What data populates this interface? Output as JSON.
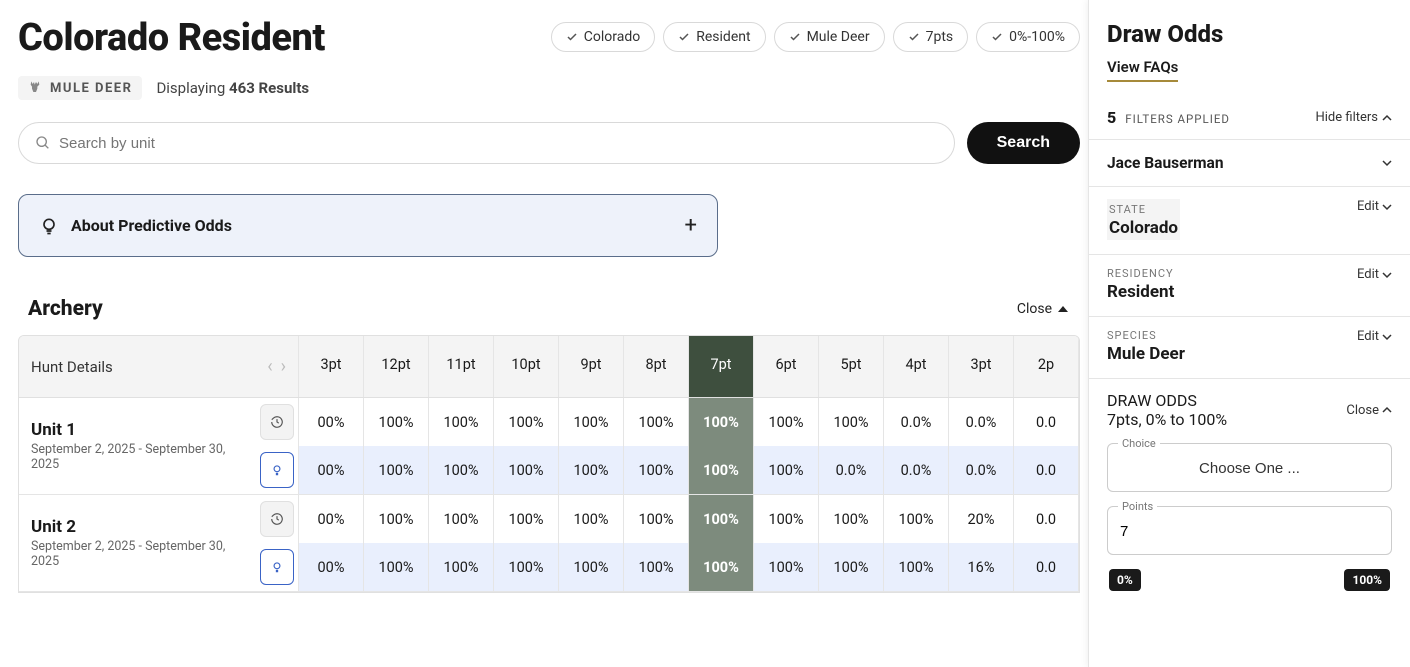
{
  "header": {
    "title": "Colorado Resident",
    "chips": [
      "Colorado",
      "Resident",
      "Mule Deer",
      "7pts",
      "0%-100%"
    ]
  },
  "species_badge": "MULE DEER",
  "results": {
    "prefix": "Displaying",
    "count": "463 Results"
  },
  "search": {
    "placeholder": "Search by unit",
    "button": "Search"
  },
  "about": {
    "title": "About Predictive Odds"
  },
  "section": {
    "title": "Archery",
    "close": "Close"
  },
  "table": {
    "hunt_details_label": "Hunt Details",
    "columns": [
      "3pt",
      "12pt",
      "11pt",
      "10pt",
      "9pt",
      "8pt",
      "7pt",
      "6pt",
      "5pt",
      "4pt",
      "3pt",
      "2p"
    ],
    "active_col_index": 6,
    "units": [
      {
        "name": "Unit 1",
        "dates": "September 2, 2025 - September 30, 2025",
        "rows": [
          [
            "00%",
            "100%",
            "100%",
            "100%",
            "100%",
            "100%",
            "100%",
            "100%",
            "100%",
            "0.0%",
            "0.0%",
            "0.0"
          ],
          [
            "00%",
            "100%",
            "100%",
            "100%",
            "100%",
            "100%",
            "100%",
            "100%",
            "0.0%",
            "0.0%",
            "0.0%",
            "0.0"
          ]
        ]
      },
      {
        "name": "Unit 2",
        "dates": "September 2, 2025 - September 30, 2025",
        "rows": [
          [
            "00%",
            "100%",
            "100%",
            "100%",
            "100%",
            "100%",
            "100%",
            "100%",
            "100%",
            "100%",
            "20%",
            "0.0"
          ],
          [
            "00%",
            "100%",
            "100%",
            "100%",
            "100%",
            "100%",
            "100%",
            "100%",
            "100%",
            "100%",
            "16%",
            "0.0"
          ]
        ]
      }
    ]
  },
  "sidebar": {
    "title": "Draw Odds",
    "faqs": "View FAQs",
    "filters_count": "5",
    "filters_label": "FILTERS APPLIED",
    "hide": "Hide filters",
    "user": "Jace Bauserman",
    "edit": "Edit",
    "close": "Close",
    "state_label": "STATE",
    "state_value": "Colorado",
    "residency_label": "RESIDENCY",
    "residency_value": "Resident",
    "species_label": "SPECIES",
    "species_value": "Mule Deer",
    "odds_label": "DRAW ODDS",
    "odds_value": "7pts, 0% to 100%",
    "choice_label": "Choice",
    "choice_value": "Choose One ...",
    "points_label": "Points",
    "points_value": "7",
    "slider_min": "0%",
    "slider_max": "100%"
  }
}
